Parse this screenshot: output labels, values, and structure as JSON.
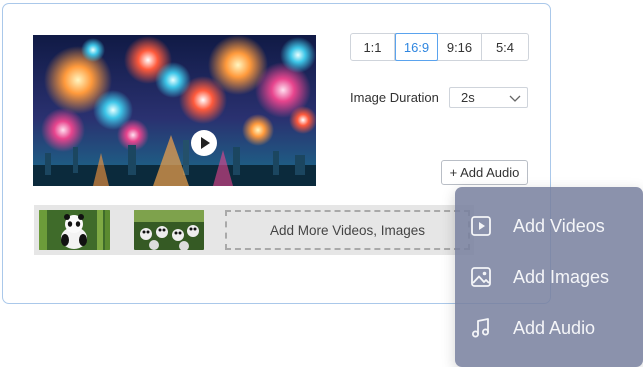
{
  "aspect_ratios": [
    {
      "label": "1:1",
      "active": false
    },
    {
      "label": "16:9",
      "active": true
    },
    {
      "label": "9:16",
      "active": false
    },
    {
      "label": "5:4",
      "active": false
    }
  ],
  "image_duration": {
    "label": "Image Duration",
    "value": "2s"
  },
  "add_audio_button": "+ Add Audio",
  "timeline": {
    "add_more_label": "Add More Videos, Images"
  },
  "menu": {
    "items": [
      {
        "label": "Add Videos",
        "icon": "play-square-icon"
      },
      {
        "label": "Add Images",
        "icon": "image-icon"
      },
      {
        "label": "Add Audio",
        "icon": "music-note-icon"
      }
    ]
  },
  "colors": {
    "accent": "#2f86e0",
    "border": "#aac8ea",
    "menu_bg": "#7b819d"
  }
}
